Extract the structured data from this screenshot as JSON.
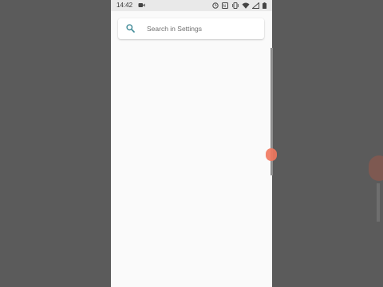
{
  "status_bar": {
    "time": "14:42",
    "icons": [
      "video-record-icon",
      "screenshot-icon",
      "nfc-icon",
      "vibrate-icon",
      "wifi-icon",
      "no-signal-icon",
      "battery-icon"
    ]
  },
  "search": {
    "placeholder": "Search in Settings",
    "icon": "search-icon"
  },
  "colors": {
    "background_dim": "#5b5b5b",
    "page": "#fafafa",
    "accent": "#3f8a97",
    "touch_indicator": "#f1775d"
  }
}
